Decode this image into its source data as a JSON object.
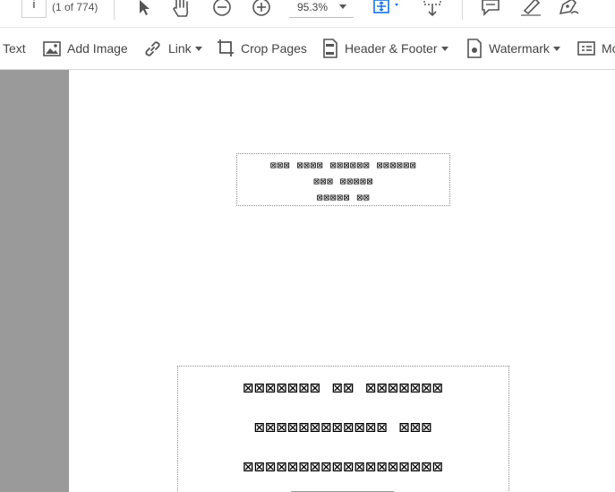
{
  "navigation": {
    "page_input_value": "i",
    "page_count_label": "(1 of 774)"
  },
  "zoom": {
    "value": "95.3%"
  },
  "edit_toolbar": {
    "text_label": "Text",
    "add_image_label": "Add Image",
    "link_label": "Link",
    "crop_pages_label": "Crop Pages",
    "header_footer_label": "Header & Footer",
    "watermark_label": "Watermark",
    "more_label": "Mo"
  },
  "document": {
    "header_block": [
      "⊠⊠⊠ ⊠⊠⊠⊠ ⊠⊠⊠⊠⊠⊠ ⊠⊠⊠⊠⊠⊠",
      "⊠⊠⊠ ⊠⊠⊠⊠⊠",
      "⊠⊠⊠⊠⊠ ⊠⊠"
    ],
    "title_block": [
      "⊠⊠⊠⊠⊠⊠⊠ ⊠⊠ ⊠⊠⊠⊠⊠⊠⊠",
      "⊠⊠⊠⊠⊠⊠⊠⊠⊠⊠⊠⊠ ⊠⊠⊠",
      "⊠⊠⊠⊠⊠⊠⊠⊠⊠⊠⊠⊠⊠⊠⊠⊠⊠⊠"
    ]
  },
  "colors": {
    "accent": "#1473e6",
    "side_panel": "#9a9a9a",
    "icon": "#555555"
  }
}
